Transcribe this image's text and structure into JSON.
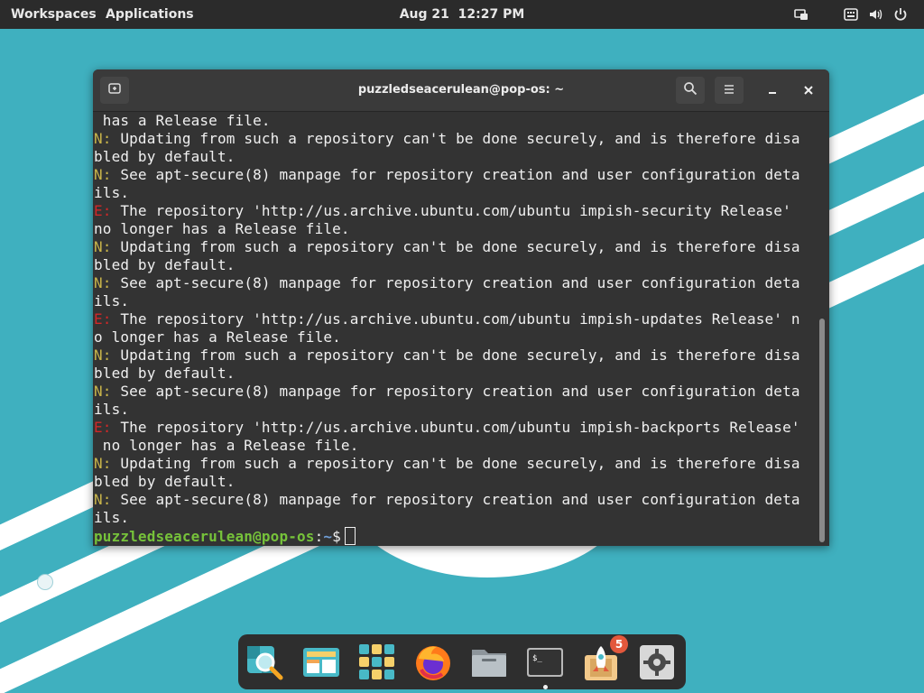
{
  "top_bar": {
    "workspaces_label": "Workspaces",
    "applications_label": "Applications",
    "clock_date": "Aug 21",
    "clock_time": "12:27 PM",
    "tray_icons": [
      "display-icon",
      "keyboard-layout-icon",
      "volume-icon",
      "power-icon"
    ]
  },
  "terminal": {
    "title": "puzzledseacerulean@pop-os: ~",
    "header_buttons": [
      "new-tab-icon",
      "search-icon",
      "hamburger-menu-icon",
      "minimize-icon",
      "close-icon"
    ],
    "lines": [
      {
        "prefix": "",
        "text": " has a Release file."
      },
      {
        "prefix": "N:",
        "text": " Updating from such a repository can't be done securely, and is therefore disa"
      },
      {
        "prefix": "",
        "text": "bled by default."
      },
      {
        "prefix": "N:",
        "text": " See apt-secure(8) manpage for repository creation and user configuration deta"
      },
      {
        "prefix": "",
        "text": "ils."
      },
      {
        "prefix": "E:",
        "text": " The repository 'http://us.archive.ubuntu.com/ubuntu impish-security Release'"
      },
      {
        "prefix": "",
        "text": "no longer has a Release file."
      },
      {
        "prefix": "N:",
        "text": " Updating from such a repository can't be done securely, and is therefore disa"
      },
      {
        "prefix": "",
        "text": "bled by default."
      },
      {
        "prefix": "N:",
        "text": " See apt-secure(8) manpage for repository creation and user configuration deta"
      },
      {
        "prefix": "",
        "text": "ils."
      },
      {
        "prefix": "E:",
        "text": " The repository 'http://us.archive.ubuntu.com/ubuntu impish-updates Release' n"
      },
      {
        "prefix": "",
        "text": "o longer has a Release file."
      },
      {
        "prefix": "N:",
        "text": " Updating from such a repository can't be done securely, and is therefore disa"
      },
      {
        "prefix": "",
        "text": "bled by default."
      },
      {
        "prefix": "N:",
        "text": " See apt-secure(8) manpage for repository creation and user configuration deta"
      },
      {
        "prefix": "",
        "text": "ils."
      },
      {
        "prefix": "E:",
        "text": " The repository 'http://us.archive.ubuntu.com/ubuntu impish-backports Release'"
      },
      {
        "prefix": "",
        "text": " no longer has a Release file."
      },
      {
        "prefix": "N:",
        "text": " Updating from such a repository can't be done securely, and is therefore disa"
      },
      {
        "prefix": "",
        "text": "bled by default."
      },
      {
        "prefix": "N:",
        "text": " See apt-secure(8) manpage for repository creation and user configuration deta"
      },
      {
        "prefix": "",
        "text": "ils."
      }
    ],
    "prompt": {
      "user_host": "puzzledseacerulean@pop-os",
      "separator": ":",
      "path": "~",
      "symbol": "$"
    }
  },
  "dock": {
    "items": [
      {
        "name": "search-launcher-icon"
      },
      {
        "name": "workspaces-icon"
      },
      {
        "name": "app-grid-icon"
      },
      {
        "name": "firefox-icon"
      },
      {
        "name": "files-icon"
      },
      {
        "name": "terminal-icon",
        "running": true
      },
      {
        "name": "pop-shop-icon",
        "badge": "5"
      },
      {
        "name": "settings-icon"
      }
    ]
  },
  "colors": {
    "desktop_bg": "#3fb0bf",
    "notice_prefix": "#c8b44a",
    "error_prefix": "#d02828",
    "prompt_user": "#76c23a",
    "prompt_path": "#6f9ed6",
    "terminal_bg": "#333333"
  }
}
